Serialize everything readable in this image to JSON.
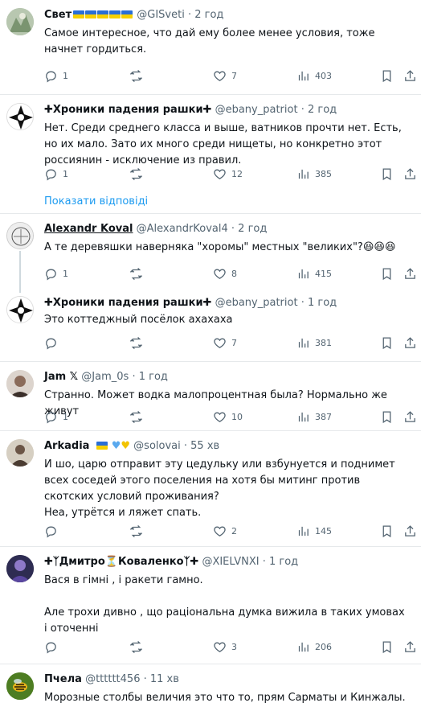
{
  "posts": [
    {
      "name": "Свет",
      "handle": "@GISveti",
      "time": "2 год",
      "flags": 5,
      "text": "Самое интересное, что дай ему более менее условия, тоже начнет гордиться.",
      "replies": "1",
      "retweets": "",
      "likes": "7",
      "views": "403"
    },
    {
      "name": "✚Хроники падения рашки✚",
      "handle": "@ebany_patriot",
      "time": "2 год",
      "text": "Нет. Среди среднего класса и выше, ватников прочти нет. Есть, но их мало. Зато их много среди нищеты, но конкретно этот россиянин - исключение из правил.",
      "replies": "1",
      "retweets": "",
      "likes": "12",
      "views": "385"
    },
    {
      "name": "Alexandr Koval",
      "handle": "@AlexandrKoval4",
      "time": "2 год",
      "text": "А те деревяшки наверняка \"хоромы\" местных \"великих\"?😆😆😆",
      "replies": "1",
      "retweets": "",
      "likes": "8",
      "views": "415"
    },
    {
      "name": "✚Хроники падения рашки✚",
      "handle": "@ebany_patriot",
      "time": "1 год",
      "text": "Это коттеджный посёлок ахахаха",
      "replies": "",
      "retweets": "",
      "likes": "7",
      "views": "381"
    },
    {
      "name": "Jam 𝕏",
      "handle": "@Jam_0s",
      "time": "1 год",
      "text": "Странно. Может водка малопроцентная была? Нормально же живут",
      "replies": "1",
      "retweets": "",
      "likes": "10",
      "views": "387"
    },
    {
      "name": "Arkadia",
      "handle": "@solovai",
      "time": "55 хв",
      "text": "И шо, царю отправит эту цедульку или взбунуется и поднимет всех соседей этого поселения на хотя бы митинг против скотских условий проживания?\nНеа, утрётся и ляжет спать.",
      "replies": "",
      "retweets": "",
      "likes": "2",
      "views": "145"
    },
    {
      "name": "✚ᛉДмитро⏳Коваленкоᛉ✚",
      "handle": "@XIELVNXI",
      "time": "1 год",
      "text": "Вася в гімні , і ракети гамно.\n\nАле трохи дивно , що раціональна думка вижила в таких умовах і оточенні",
      "replies": "",
      "retweets": "",
      "likes": "3",
      "views": "206"
    },
    {
      "name": "Пчела",
      "handle": "@tttttt456",
      "time": "11 хв",
      "text": "Морозные столбы величия это что то, прям Сарматы и Кинжалы.",
      "replies": "",
      "retweets": "",
      "likes": "",
      "views": ""
    }
  ],
  "show_replies_label": "Показати відповіді",
  "colors": {
    "accent": "#1d9bf0",
    "muted": "#536471",
    "divider": "#e6e9eb"
  }
}
